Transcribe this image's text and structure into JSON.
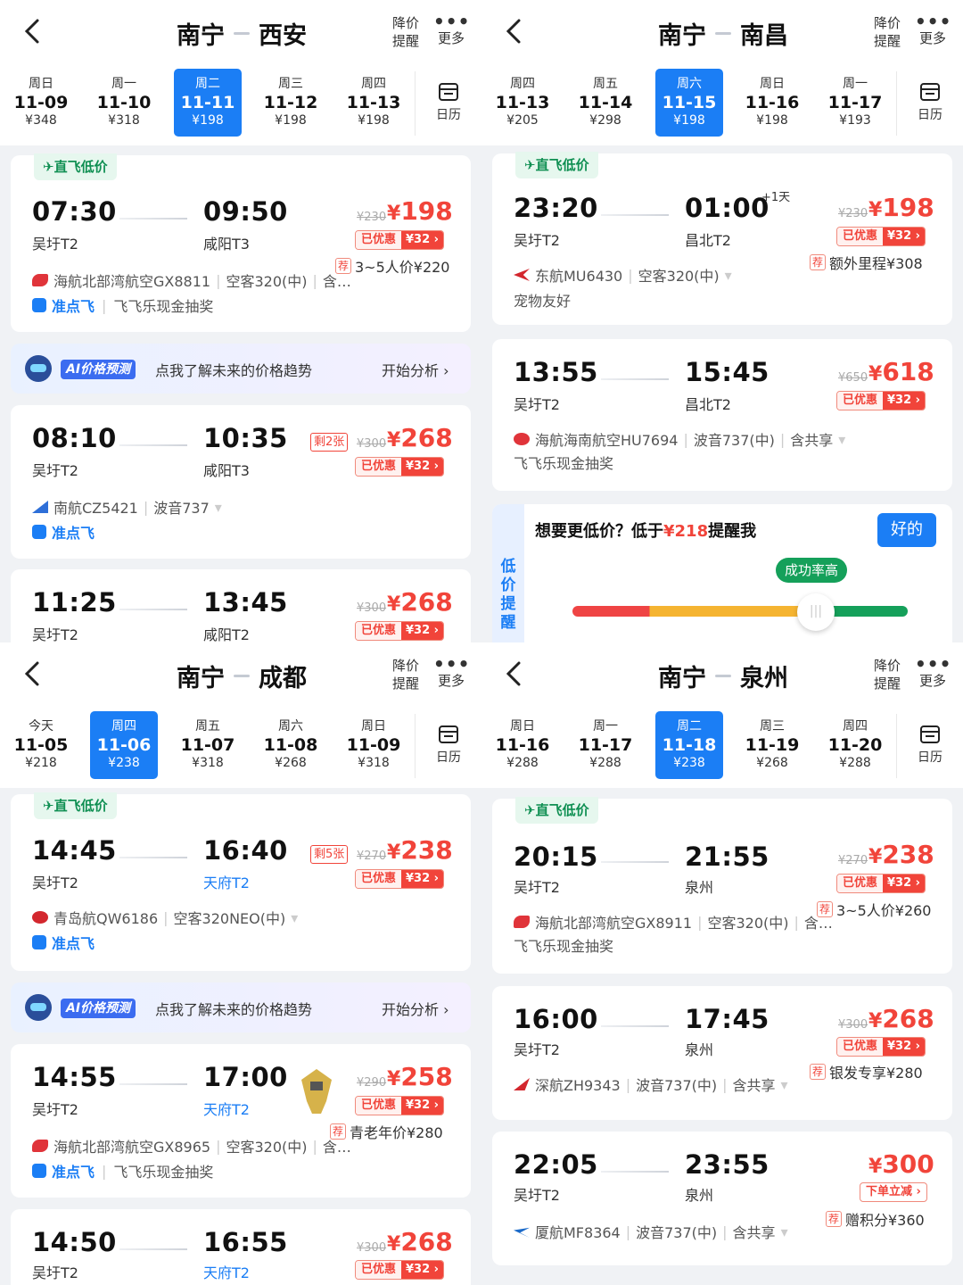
{
  "panels": [
    {
      "route": {
        "from": "南宁",
        "to": "西安"
      },
      "alert_label": "降价\n提醒",
      "more_label": "更多",
      "calendar_label": "日历",
      "dates": [
        {
          "wd": "周日",
          "d": "11-09",
          "p": "¥348"
        },
        {
          "wd": "周一",
          "d": "11-10",
          "p": "¥318"
        },
        {
          "wd": "周二",
          "d": "11-11",
          "p": "¥198",
          "selected": true
        },
        {
          "wd": "周三",
          "d": "11-12",
          "p": "¥198"
        },
        {
          "wd": "周四",
          "d": "11-13",
          "p": "¥198"
        }
      ],
      "flights": [
        {
          "tag": "✈直飞低价",
          "dep": "07:30",
          "dep_ap": "吴圩T2",
          "arr": "09:50",
          "arr_ap": "咸阳T3",
          "old": "¥230",
          "price": "198",
          "disc_a": "已优惠",
          "disc_b": "¥32 ›",
          "rec": "3~5人价¥220",
          "airline": "海航北部湾航空GX8811",
          "plane": "空客320(中)",
          "extra": "含…",
          "punctual": "准点飞",
          "other": "飞飞乐现金抽奖",
          "logo_color": "#e0343a"
        },
        {
          "dep": "08:10",
          "dep_ap": "吴圩T2",
          "arr": "10:35",
          "arr_ap": "咸阳T3",
          "left": "剩2张",
          "old": "¥300",
          "price": "268",
          "disc_a": "已优惠",
          "disc_b": "¥32 ›",
          "airline": "南航CZ5421",
          "plane": "波音737",
          "punctual": "准点飞",
          "logo_color": "#2e6fd8"
        },
        {
          "dep": "11:25",
          "dep_ap": "吴圩T2",
          "arr": "13:45",
          "arr_ap": "咸阳T2",
          "old": "¥300",
          "price": "268",
          "disc_a": "已优惠",
          "disc_b": "¥32 ›"
        }
      ],
      "ai": {
        "badge": "AI价格预测",
        "text": "点我了解未来的价格趋势",
        "go": "开始分析 ›"
      }
    },
    {
      "route": {
        "from": "南宁",
        "to": "南昌"
      },
      "alert_label": "降价\n提醒",
      "more_label": "更多",
      "calendar_label": "日历",
      "dates": [
        {
          "wd": "周四",
          "d": "11-13",
          "p": "¥205"
        },
        {
          "wd": "周五",
          "d": "11-14",
          "p": "¥298"
        },
        {
          "wd": "周六",
          "d": "11-15",
          "p": "¥198",
          "selected": true
        },
        {
          "wd": "周日",
          "d": "11-16",
          "p": "¥198"
        },
        {
          "wd": "周一",
          "d": "11-17",
          "p": "¥193"
        }
      ],
      "flights": [
        {
          "tag": "✈直飞低价",
          "dep": "23:20",
          "dep_ap": "吴圩T2",
          "arr": "01:00",
          "arr_ap": "昌北T2",
          "plus": "+1天",
          "old": "¥230",
          "price": "198",
          "disc_a": "已优惠",
          "disc_b": "¥32 ›",
          "rec": "额外里程¥308",
          "airline": "东航MU6430",
          "plane": "空客320(中)",
          "other_line": "宠物友好",
          "logo_color": "#d3272e"
        },
        {
          "dep": "13:55",
          "dep_ap": "吴圩T2",
          "arr": "15:45",
          "arr_ap": "昌北T2",
          "old": "¥650",
          "price": "618",
          "disc_a": "已优惠",
          "disc_b": "¥32 ›",
          "airline": "海航海南航空HU7694",
          "plane": "波音737(中)",
          "extra": "含共享",
          "other_line": "飞飞乐现金抽奖",
          "logo_color": "#e0343a"
        }
      ],
      "lowprice": {
        "side": "低\n价\n提\n醒",
        "q_a": "想要更低价？低于",
        "q_price": "¥218",
        "q_b": "提醒我",
        "ok": "好的",
        "rate": "成功率高"
      }
    },
    {
      "route": {
        "from": "南宁",
        "to": "成都"
      },
      "alert_label": "降价\n提醒",
      "more_label": "更多",
      "calendar_label": "日历",
      "dates": [
        {
          "wd": "今天",
          "d": "11-05",
          "p": "¥218"
        },
        {
          "wd": "周四",
          "d": "11-06",
          "p": "¥238",
          "selected": true
        },
        {
          "wd": "周五",
          "d": "11-07",
          "p": "¥318"
        },
        {
          "wd": "周六",
          "d": "11-08",
          "p": "¥268"
        },
        {
          "wd": "周日",
          "d": "11-09",
          "p": "¥318"
        }
      ],
      "flights": [
        {
          "tag": "✈直飞低价",
          "dep": "14:45",
          "dep_ap": "吴圩T2",
          "arr": "16:40",
          "arr_ap": "天府T2",
          "left": "剩5张",
          "old": "¥270",
          "price": "238",
          "disc_a": "已优惠",
          "disc_b": "¥32 ›",
          "airline": "青岛航QW6186",
          "plane": "空客320NEO(中)",
          "punctual": "准点飞",
          "logo_color": "#d3272e"
        },
        {
          "dep": "14:55",
          "dep_ap": "吴圩T2",
          "arr": "17:00",
          "arr_ap": "天府T2",
          "old": "¥290",
          "price": "258",
          "disc_a": "已优惠",
          "disc_b": "¥32 ›",
          "rec": "青老年价¥280",
          "airline": "海航北部湾航空GX8965",
          "plane": "空客320(中)",
          "extra": "含…",
          "punctual": "准点飞",
          "other": "飞飞乐现金抽奖",
          "logo_color": "#e0343a"
        },
        {
          "dep": "14:50",
          "dep_ap": "吴圩T2",
          "arr": "16:55",
          "arr_ap": "天府T2",
          "old": "¥300",
          "price": "268",
          "disc_a": "已优惠",
          "disc_b": "¥32 ›"
        }
      ],
      "ai": {
        "badge": "AI价格预测",
        "text": "点我了解未来的价格趋势",
        "go": "开始分析 ›"
      }
    },
    {
      "route": {
        "from": "南宁",
        "to": "泉州"
      },
      "alert_label": "降价\n提醒",
      "more_label": "更多",
      "calendar_label": "日历",
      "dates": [
        {
          "wd": "周日",
          "d": "11-16",
          "p": "¥288"
        },
        {
          "wd": "周一",
          "d": "11-17",
          "p": "¥288"
        },
        {
          "wd": "周二",
          "d": "11-18",
          "p": "¥238",
          "selected": true
        },
        {
          "wd": "周三",
          "d": "11-19",
          "p": "¥268"
        },
        {
          "wd": "周四",
          "d": "11-20",
          "p": "¥288"
        }
      ],
      "flights": [
        {
          "tag": "✈直飞低价",
          "dep": "20:15",
          "dep_ap": "吴圩T2",
          "arr": "21:55",
          "arr_ap": "泉州",
          "old": "¥270",
          "price": "238",
          "disc_a": "已优惠",
          "disc_b": "¥32 ›",
          "rec": "3~5人价¥260",
          "airline": "海航北部湾航空GX8911",
          "plane": "空客320(中)",
          "extra": "含…",
          "other_line": "飞飞乐现金抽奖",
          "logo_color": "#e0343a"
        },
        {
          "dep": "16:00",
          "dep_ap": "吴圩T2",
          "arr": "17:45",
          "arr_ap": "泉州",
          "old": "¥300",
          "price": "268",
          "disc_a": "已优惠",
          "disc_b": "¥32 ›",
          "rec": "银发专享¥280",
          "airline": "深航ZH9343",
          "plane": "波音737(中)",
          "extra": "含共享",
          "logo_color": "#d3272e"
        },
        {
          "dep": "22:05",
          "dep_ap": "吴圩T2",
          "arr": "23:55",
          "arr_ap": "泉州",
          "price": "300",
          "disc_single": "下单立减 ›",
          "rec": "赠积分¥360",
          "airline": "厦航MF8364",
          "plane": "波音737(中)",
          "extra": "含共享",
          "logo_color": "#1b6ac9"
        }
      ]
    }
  ]
}
